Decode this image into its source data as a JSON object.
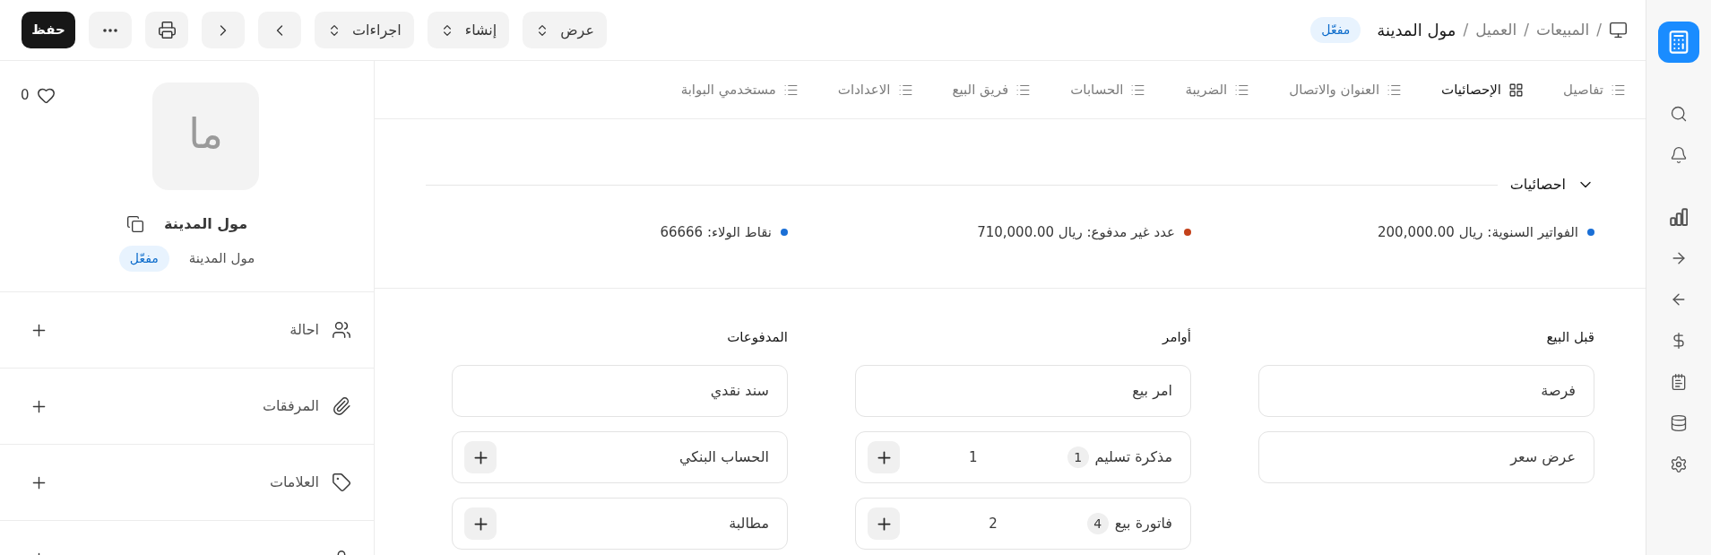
{
  "breadcrumb": {
    "items": [
      {
        "separator": "/",
        "label": "المبيعات",
        "current": false
      },
      {
        "separator": "/",
        "label": "العميل",
        "current": false
      },
      {
        "separator": "/",
        "label": "مول المدينة",
        "current": true
      }
    ],
    "status": "مفعّل"
  },
  "toolbar": {
    "menus": [
      {
        "label": "عرض"
      },
      {
        "label": "إنشاء"
      },
      {
        "label": "اجراءات"
      }
    ],
    "save": "حفظ"
  },
  "tabs": [
    {
      "label": "تفاصيل",
      "selected": false
    },
    {
      "label": "الإحصائيات",
      "selected": true
    },
    {
      "label": "العنوان والاتصال",
      "selected": false
    },
    {
      "label": "الضريبة",
      "selected": false
    },
    {
      "label": "الحسابات",
      "selected": false
    },
    {
      "label": "فريق البيع",
      "selected": false
    },
    {
      "label": "الاعدادات",
      "selected": false
    },
    {
      "label": "مستخدمي البوابة",
      "selected": false
    }
  ],
  "statistics": {
    "title": "احصائيات",
    "expanded": true,
    "items": [
      {
        "text": "الفواتير السنوية: ريال 200,000.00",
        "color": "#1a6fd6"
      },
      {
        "text": "عدد غير مدفوع: ريال 710,000.00",
        "color": "#c4411a"
      },
      {
        "text": "نقاط الولاء: 66666",
        "color": "#1a6fd6"
      }
    ]
  },
  "link_groups": [
    {
      "title": "قبل البيع",
      "items": [
        {
          "label": "فرصة",
          "kind": "plain"
        },
        {
          "label": "عرض سعر",
          "kind": "plain"
        }
      ]
    },
    {
      "title": "أوامر",
      "items": [
        {
          "label": "امر بيع",
          "kind": "plain"
        },
        {
          "label": "مذكرة تسليم",
          "kind": "add",
          "count": "1",
          "number": "1"
        },
        {
          "label": "فاتورة بيع",
          "kind": "add",
          "count": "4",
          "number": "2"
        }
      ]
    },
    {
      "title": "المدفوعات",
      "items": [
        {
          "label": "سند نقدي",
          "kind": "plain"
        },
        {
          "label": "الحساب البنكي",
          "kind": "add"
        },
        {
          "label": "مطالبة",
          "kind": "add"
        }
      ]
    }
  ],
  "sidebar": {
    "liked": false,
    "likes": "0",
    "avatar": "ما",
    "name": "مول المدينة",
    "subtitle": "مول المدينة",
    "status": "مفعّل",
    "sections": [
      {
        "kind": "assign",
        "label": "احالة"
      },
      {
        "kind": "attach",
        "label": "المرفقات"
      },
      {
        "kind": "tags",
        "label": "العلامات"
      },
      {
        "kind": "share"
      }
    ]
  }
}
